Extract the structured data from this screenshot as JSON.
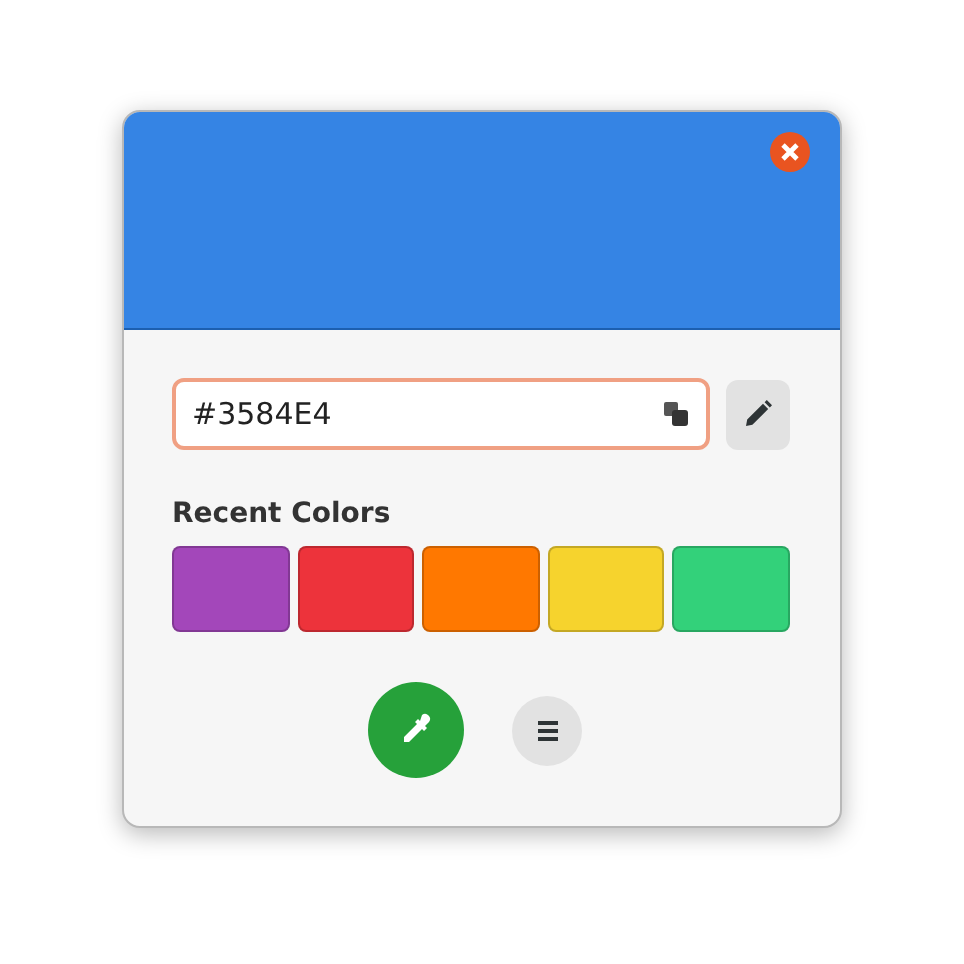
{
  "preview": {
    "color": "#3584e4"
  },
  "hex_field": {
    "value": "#3584E4"
  },
  "recent_colors": {
    "label": "Recent Colors",
    "swatches": [
      {
        "color": "#a347ba"
      },
      {
        "color": "#ed333b"
      },
      {
        "color": "#ff7800"
      },
      {
        "color": "#f6d32d"
      },
      {
        "color": "#33d17a"
      }
    ]
  }
}
